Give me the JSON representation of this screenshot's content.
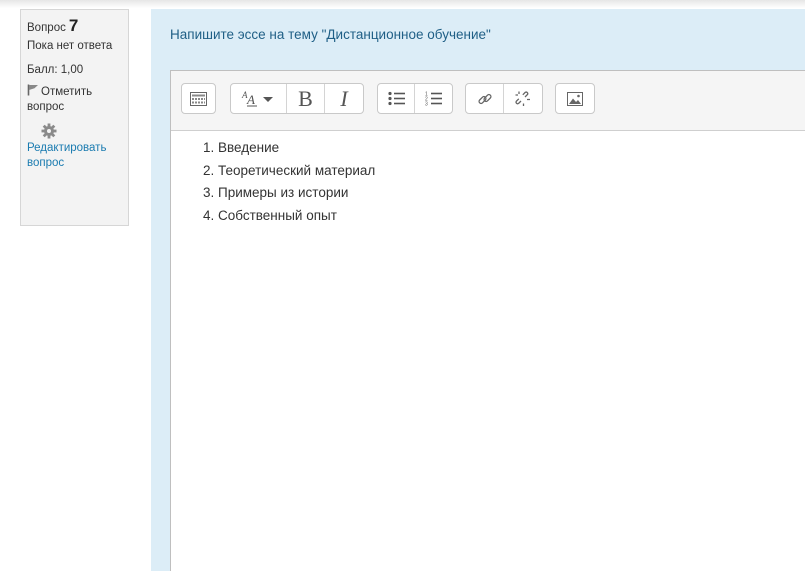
{
  "question_info": {
    "label": "Вопрос",
    "number": "7",
    "state": "Пока нет ответа",
    "grade": "Балл: 1,00",
    "flag_label": "Отметить вопрос",
    "edit_label": "Редактировать вопрос"
  },
  "question": {
    "text": "Напишите эссе на тему \"Дистанционное обучение\""
  },
  "editor": {
    "toolbar": [
      "show-more-buttons-icon",
      "text-style-icon",
      "bold-icon",
      "italic-icon",
      "unordered-list-icon",
      "ordered-list-icon",
      "link-icon",
      "unlink-icon",
      "image-icon"
    ],
    "bold_glyph": "B",
    "italic_glyph": "I",
    "items": [
      "1. Введение",
      "2. Теоретический материал",
      "3. Примеры из истории",
      "4. Собственный опыт"
    ]
  },
  "colors": {
    "content_bg": "#dcedf7",
    "question_text": "#1f5f86",
    "link": "#1a7bb0",
    "info_bg": "#f3f3f3"
  }
}
